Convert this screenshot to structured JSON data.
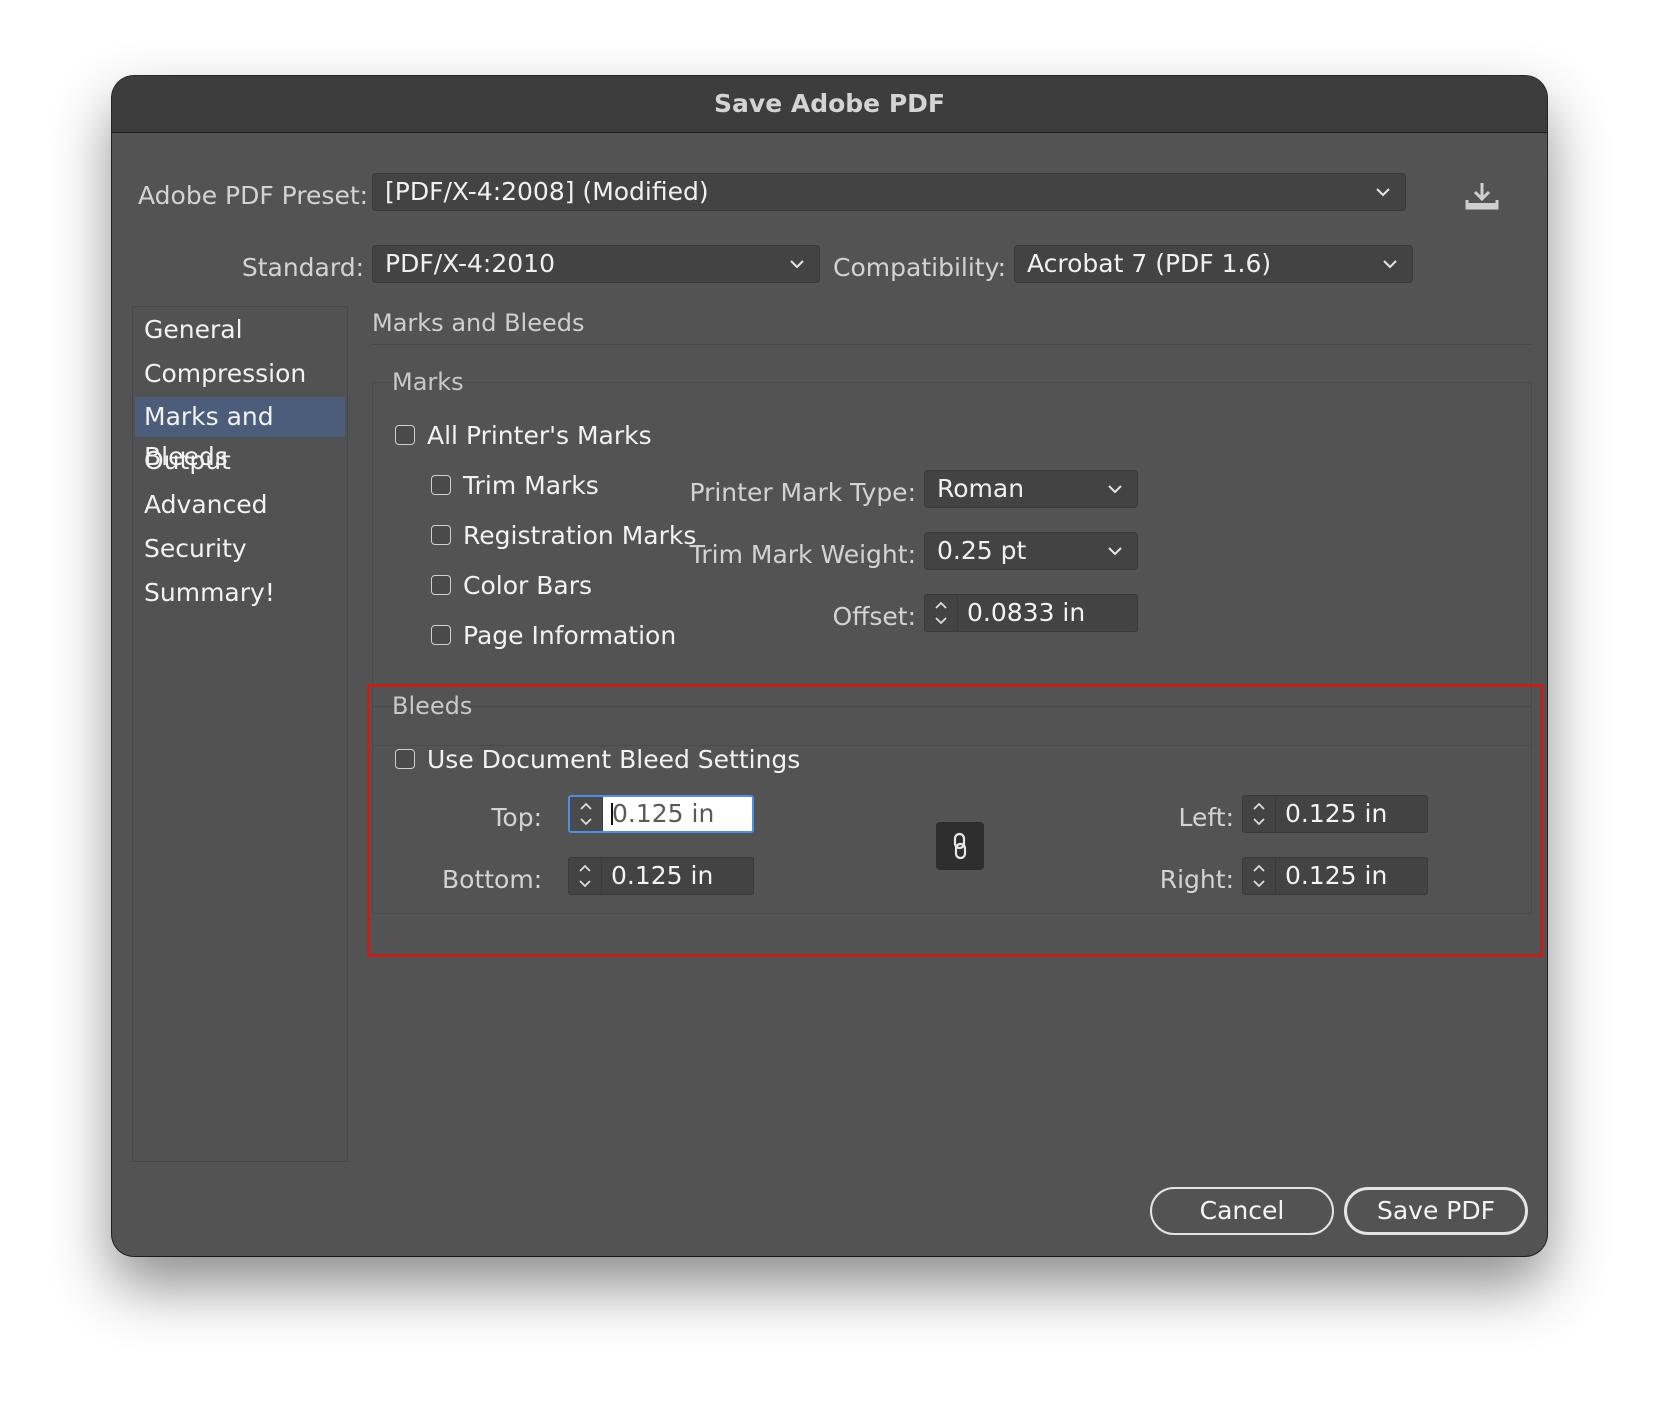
{
  "window": {
    "title": "Save Adobe PDF"
  },
  "preset": {
    "label": "Adobe PDF Preset:",
    "value": "[PDF/X-4:2008] (Modified)",
    "icon": "save-preset-icon"
  },
  "standard": {
    "label": "Standard:",
    "value": "PDF/X-4:2010"
  },
  "compatibility": {
    "label": "Compatibility:",
    "value": "Acrobat 7 (PDF 1.6)"
  },
  "sidebar": {
    "items": [
      {
        "label": "General",
        "active": false
      },
      {
        "label": "Compression",
        "active": false
      },
      {
        "label": "Marks and Bleeds",
        "active": true
      },
      {
        "label": "Output",
        "active": false
      },
      {
        "label": "Advanced",
        "active": false
      },
      {
        "label": "Security",
        "active": false
      },
      {
        "label": "Summary!",
        "active": false
      }
    ]
  },
  "panel": {
    "heading": "Marks and Bleeds",
    "marks": {
      "title": "Marks",
      "all_printers_marks": {
        "label": "All Printer's Marks",
        "checked": false
      },
      "trim_marks": {
        "label": "Trim Marks",
        "checked": false
      },
      "registration_marks": {
        "label": "Registration Marks",
        "checked": false
      },
      "color_bars": {
        "label": "Color Bars",
        "checked": false
      },
      "page_information": {
        "label": "Page Information",
        "checked": false
      },
      "printer_mark_type": {
        "label": "Printer Mark Type:",
        "value": "Roman"
      },
      "trim_mark_weight": {
        "label": "Trim Mark Weight:",
        "value": "0.25 pt"
      },
      "offset": {
        "label": "Offset:",
        "value": "0.0833 in"
      }
    },
    "bleeds": {
      "title": "Bleeds",
      "use_document": {
        "label": "Use Document Bleed Settings",
        "checked": false
      },
      "top": {
        "label": "Top:",
        "value": "0.125 in"
      },
      "bottom": {
        "label": "Bottom:",
        "value": "0.125 in"
      },
      "left": {
        "label": "Left:",
        "value": "0.125 in"
      },
      "right": {
        "label": "Right:",
        "value": "0.125 in"
      },
      "link_icon": "link-icon"
    }
  },
  "buttons": {
    "cancel": "Cancel",
    "save": "Save PDF"
  },
  "colors": {
    "dialog_bg": "#535353",
    "active_nav": "#4b5d7a",
    "highlight": "#c0221b",
    "focus": "#4e8fdf"
  }
}
